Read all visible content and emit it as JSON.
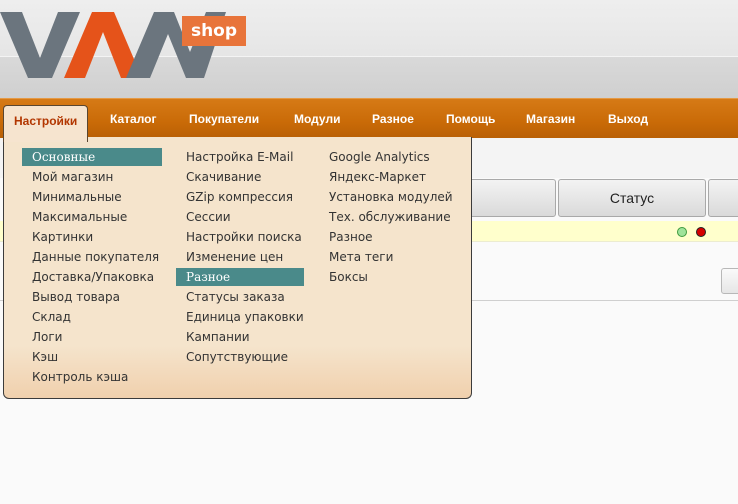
{
  "header": {
    "logo_text": "VAM",
    "shop_badge": "shop"
  },
  "nav": {
    "items": [
      {
        "label": "Настройки",
        "active": true
      },
      {
        "label": "Каталог"
      },
      {
        "label": "Покупатели"
      },
      {
        "label": "Модули"
      },
      {
        "label": "Разное"
      },
      {
        "label": "Помощь"
      },
      {
        "label": "Магазин"
      },
      {
        "label": "Выход"
      }
    ]
  },
  "dropdown": {
    "col1": [
      {
        "label": "Основные",
        "selected": true
      },
      {
        "label": "Мой магазин"
      },
      {
        "label": "Минимальные"
      },
      {
        "label": "Максимальные"
      },
      {
        "label": "Картинки"
      },
      {
        "label": "Данные покупателя"
      },
      {
        "label": "Доставка/Упаковка"
      },
      {
        "label": "Вывод товара"
      },
      {
        "label": "Склад"
      },
      {
        "label": "Логи"
      },
      {
        "label": "Кэш"
      },
      {
        "label": "Контроль кэша"
      }
    ],
    "col2": [
      {
        "label": "Настройка E-Mail"
      },
      {
        "label": "Скачивание"
      },
      {
        "label": "GZip компрессия"
      },
      {
        "label": "Сессии"
      },
      {
        "label": "Настройки поиска"
      },
      {
        "label": "Изменение цен"
      },
      {
        "label": "Разное",
        "selected": true
      },
      {
        "label": "Статусы заказа"
      },
      {
        "label": "Единица упаковки"
      },
      {
        "label": "Кампании"
      },
      {
        "label": "Сопутствующие"
      }
    ],
    "col3": [
      {
        "label": "Google Analytics"
      },
      {
        "label": "Яндекс-Маркет"
      },
      {
        "label": "Установка модулей"
      },
      {
        "label": "Тех. обслуживание"
      },
      {
        "label": "Разное"
      },
      {
        "label": "Мета теги"
      },
      {
        "label": "Боксы"
      }
    ]
  },
  "table": {
    "status_header": "Статус"
  },
  "colors": {
    "nav_orange": "#c96a07",
    "dropdown_bg": "#f5e4cc",
    "selected_bg": "#4a8a8a",
    "active_tab_text": "#b23600",
    "logo_gray": "#6b757e",
    "logo_orange": "#e5531a"
  }
}
